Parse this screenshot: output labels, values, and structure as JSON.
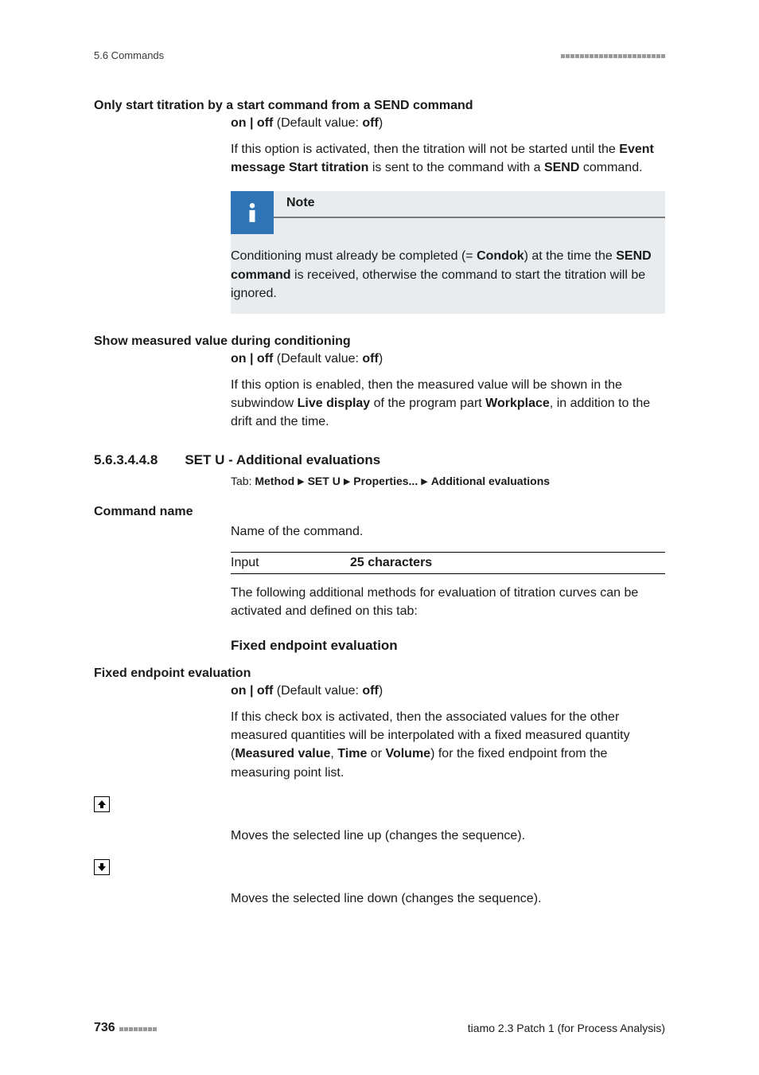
{
  "header": {
    "section_ref": "5.6 Commands"
  },
  "s1": {
    "title": "Only start titration by a start command from a SEND command",
    "val_pre": "on | off",
    "val_mid": " (Default value: ",
    "val_bold": "off",
    "val_post": ")",
    "p_a": "If this option is activated, then the titration will not be started until the ",
    "p_b": "Event message Start titration",
    "p_c": " is sent to the command with a ",
    "p_d": "SEND",
    "p_e": " command."
  },
  "note": {
    "title": "Note",
    "a": "Conditioning must already be completed (= ",
    "b": "Condok",
    "c": ") at the time the ",
    "d": "SEND command",
    "e": " is received, otherwise the command to start the titration will be ignored."
  },
  "s2": {
    "title": "Show measured value during conditioning",
    "val_pre": "on | off",
    "val_mid": " (Default value: ",
    "val_bold": "off",
    "val_post": ")",
    "p_a": "If this option is enabled, then the measured value will be shown in the subwindow ",
    "p_b": "Live display",
    "p_c": " of the program part ",
    "p_d": "Workplace",
    "p_e": ", in addition to the drift and the time."
  },
  "sec": {
    "num": "5.6.3.4.4.8",
    "title": "SET U - Additional evaluations",
    "tab_label": "Tab: ",
    "crumb1": "Method",
    "crumb2": "SET U",
    "crumb3": "Properties...",
    "crumb4": "Additional evaluations"
  },
  "cmd": {
    "title": "Command name",
    "desc": "Name of the command.",
    "input_label": "Input",
    "input_val": "25 characters",
    "after": "The following additional methods for evaluation of titration curves can be activated and defined on this tab:"
  },
  "fep": {
    "heading": "Fixed endpoint evaluation",
    "field": "Fixed endpoint evaluation",
    "val_pre": "on | off",
    "val_mid": " (Default value: ",
    "val_bold": "off",
    "val_post": ")",
    "p_a": "If this check box is activated, then the associated values for the other measured quantities will be interpolated with a fixed measured quantity (",
    "p_b": "Measured value",
    "p_c": ", ",
    "p_d": "Time",
    "p_e": " or ",
    "p_f": "Volume",
    "p_g": ") for the fixed endpoint from the measuring point list."
  },
  "arrows": {
    "up_desc": "Moves the selected line up (changes the sequence).",
    "down_desc": "Moves the selected line down (changes the sequence)."
  },
  "footer": {
    "page": "736",
    "product": "tiamo 2.3 Patch 1 (for Process Analysis)"
  }
}
